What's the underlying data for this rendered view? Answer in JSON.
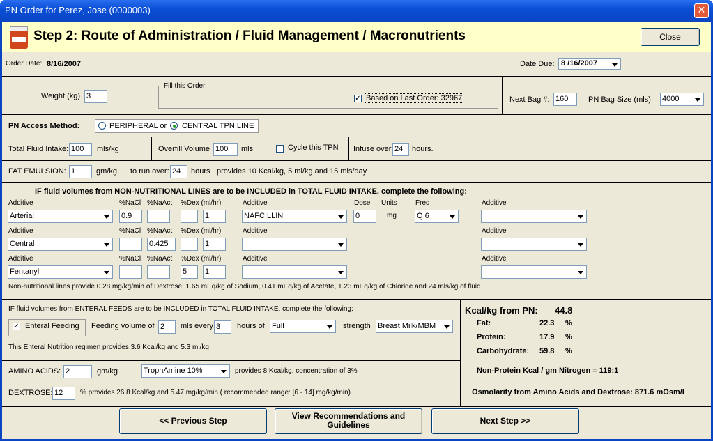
{
  "window": {
    "title": "PN Order for Perez, Jose (0000003)"
  },
  "header": {
    "heading": "Step 2: Route of Administration / Fluid Management / Macronutrients",
    "close_label": "Close"
  },
  "order": {
    "order_date_label": "Order Date:",
    "order_date": "8/16/2007",
    "date_due_label": "Date Due:",
    "date_due": "8 /16/2007"
  },
  "weight": {
    "label": "Weight (kg)",
    "value": "3"
  },
  "fill": {
    "group_label": "Fill this Order",
    "based_label": "Based on Last Order: 32967",
    "checked": "✓"
  },
  "bag": {
    "next_label": "Next Bag #:",
    "next_value": "160",
    "size_label": "PN Bag Size (mls)",
    "size_value": "4000"
  },
  "access": {
    "label": "PN Access Method:",
    "peripheral": "PERIPHERAL or",
    "central": "CENTRAL TPN  LINE"
  },
  "fluid": {
    "total_label": "Total Fluid Intake:",
    "total_value": "100",
    "total_unit": "mls/kg",
    "overfill_label": "Overfill Volume",
    "overfill_value": "100",
    "overfill_unit": "mls",
    "cycle_label": "Cycle this TPN",
    "infuse_label": "Infuse over",
    "infuse_value": "24",
    "infuse_unit": "hours."
  },
  "fat": {
    "label": "FAT EMULSION:",
    "value": "1",
    "unit": "gm/kg,",
    "run_label": "to run over:",
    "run_value": "24",
    "run_unit": "hours",
    "provides": "provides 10 Kcal/kg, 5 ml/kg and 15 mls/day"
  },
  "nonnut": {
    "heading": "IF fluid volumes from NON-NUTRITIONAL LINES are to be INCLUDED in TOTAL FLUID INTAKE, complete the following:",
    "col_additive": "Additive",
    "col_nacl": "%NaCl",
    "col_naact": "%NaAct",
    "col_dex": "%Dex",
    "col_mlhr": "(ml/hr)",
    "col_dexmlhr": "%Dex  (ml/hr)",
    "col_dose": "Dose",
    "col_units": "Units",
    "col_freq": "Freq",
    "rows": [
      {
        "additive": "Arterial",
        "nacl": "0.9",
        "naact": "",
        "dex": "",
        "mlhr": "1",
        "add2": "NAFCILLIN",
        "dose": "0",
        "units": "mg",
        "freq": "Q 6",
        "add3": ""
      },
      {
        "additive": "Central",
        "nacl": "",
        "naact": "0.425",
        "dex": "",
        "mlhr": "1",
        "add2": "",
        "add3": ""
      },
      {
        "additive": "Fentanyl",
        "nacl": "",
        "naact": "",
        "dex": "5",
        "mlhr": "1",
        "add2": "",
        "add3": ""
      }
    ],
    "summary": "Non-nutritional lines provide 0.28 mg/kg/min of Dextrose, 1.65 mEq/kg of Sodium, 0.41 mEq/kg of Acetate, 1.23 mEq/kg of Chloride  and 24 mls/kg of fluid"
  },
  "enteral": {
    "heading": "IF fluid volumes from ENTERAL FEEDS are to be INCLUDED in TOTAL FLUID INTAKE, complete the following:",
    "checkbox_label": "Enteral Feeding",
    "checked": "✓",
    "volume_label": "Feeding volume of",
    "volume_value": "2",
    "every_label": "mls every",
    "every_value": "3",
    "hours_label": "hours of",
    "strength_type": "Full",
    "strength_label": "strength",
    "formula": "Breast Milk/MBM",
    "summary": "This Enteral Nutrition regimen provides 3.6 Kcal/kg and 5.3 ml/kg"
  },
  "amino": {
    "label": "AMINO ACIDS:",
    "value": "2",
    "unit": "gm/kg",
    "product": "TrophAmine 10%",
    "provides": "provides 8 Kcal/kg, concentration of 3%"
  },
  "dextrose": {
    "label": "DEXTROSE:",
    "value": "12",
    "provides": "% provides 26.8 Kcal/kg and 5.47 mg/kg/min ( recommended range: [6 - 14] mg/kg/min)"
  },
  "summary_panel": {
    "kcal_label": "Kcal/kg from PN:",
    "kcal_value": "44.8",
    "fat_label": "Fat:",
    "fat_value": "22.3",
    "protein_label": "Protein:",
    "protein_value": "17.9",
    "carb_label": "Carbohydrate:",
    "carb_value": "59.8",
    "pct": "%",
    "npc_label": "Non-Protein Kcal / gm Nitrogen = 119:1",
    "osm_label": "Osmolarity from Amino Acids and Dextrose: 871.6 mOsm/l"
  },
  "nav": {
    "prev": "<< Previous Step",
    "recs_line1": "View Recommendations and",
    "recs_line2": "Guidelines",
    "next": "Next Step >>"
  }
}
